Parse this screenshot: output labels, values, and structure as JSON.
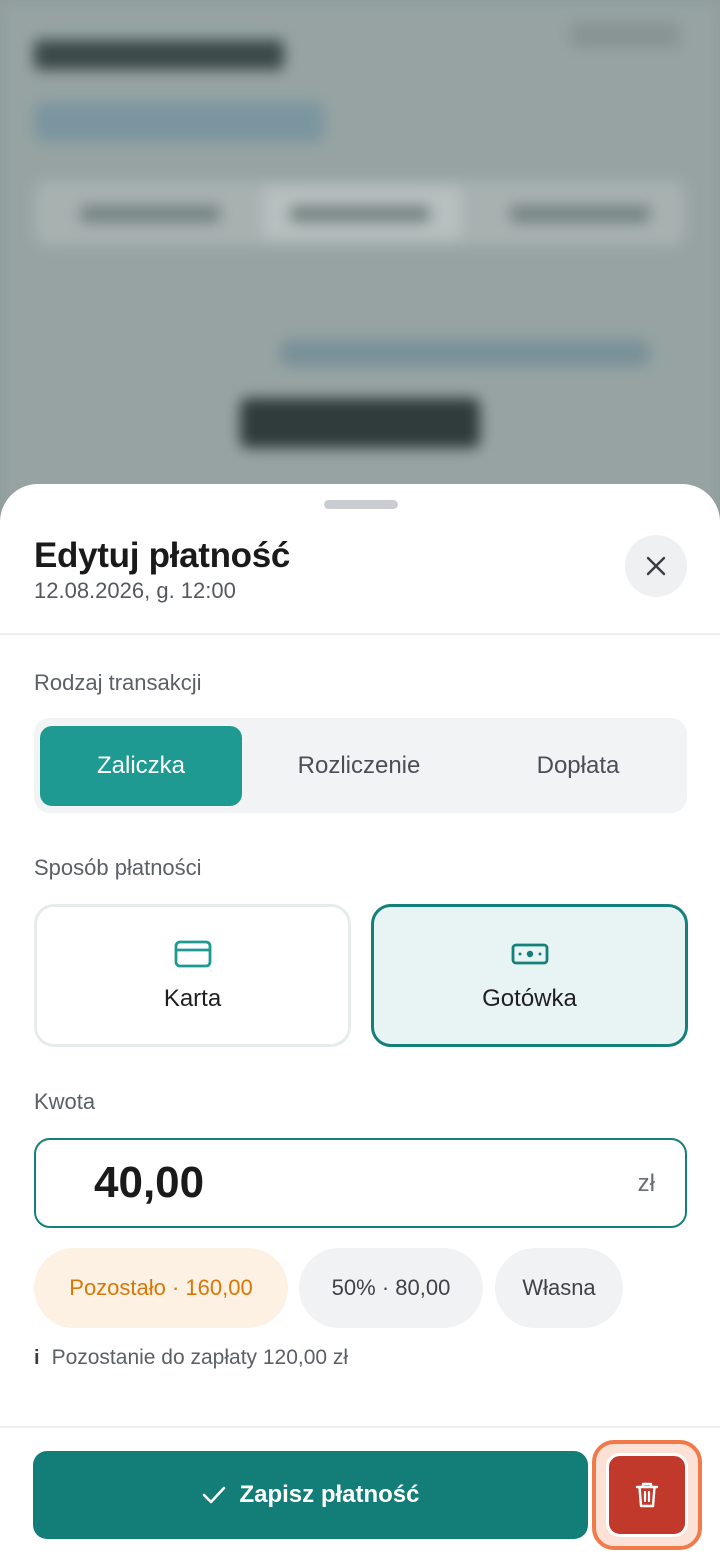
{
  "sheet": {
    "title": "Edytuj płatność",
    "subtitle": "12.08.2026, g. 12:00",
    "close_icon": "close-icon"
  },
  "transaction_type": {
    "label": "Rodzaj transakcji",
    "options": [
      "Zaliczka",
      "Rozliczenie",
      "Dopłata"
    ],
    "selected": "Zaliczka"
  },
  "payment_method": {
    "label": "Sposób płatności",
    "options": [
      {
        "label": "Karta",
        "icon": "credit-card-icon"
      },
      {
        "label": "Gotówka",
        "icon": "cash-icon"
      }
    ],
    "selected": "Gotówka"
  },
  "amount": {
    "label": "Kwota",
    "value": "40,00",
    "unit": "zł"
  },
  "quick_amounts": [
    {
      "label": "Pozostało · 160,00"
    },
    {
      "label": "50% · 80,00"
    },
    {
      "label": "Własna"
    }
  ],
  "info": {
    "mark": "i",
    "text": "Pozostanie do zapłaty 120,00 zł"
  },
  "actions": {
    "save_label": "Zapisz płatność",
    "save_icon": "checkmark-icon",
    "delete_icon": "trash-icon"
  },
  "colors": {
    "accent": "#1e9a92",
    "primary_button": "#137d77",
    "danger": "#c0392b",
    "warning_text": "#d97706"
  }
}
